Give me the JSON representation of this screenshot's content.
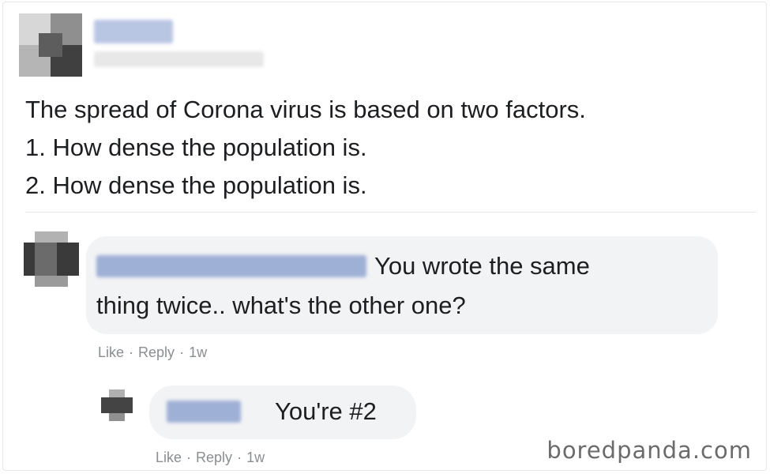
{
  "post": {
    "text_lines": [
      "The spread of Corona virus is based on two factors.",
      "1. How dense the population is.",
      "2. How dense the population is."
    ]
  },
  "comments": [
    {
      "text_line1": "You wrote the same",
      "text_line2": "thing twice.. what's the other one?",
      "like": "Like",
      "reply": "Reply",
      "sep": "·",
      "time": "1w"
    },
    {
      "text": "You're #2",
      "like": "Like",
      "reply": "Reply",
      "sep": "·",
      "time": "1w"
    }
  ],
  "watermark": "boredpanda.com",
  "colors": {
    "bubble": "#f2f3f5",
    "action_text": "#8a8d91",
    "blur_name": "#9fb0d6"
  },
  "icons": {
    "poster_avatar": "pixelated-avatar-icon",
    "commenter_avatar": "pixelated-avatar-icon",
    "replier_avatar": "pixelated-avatar-icon"
  }
}
